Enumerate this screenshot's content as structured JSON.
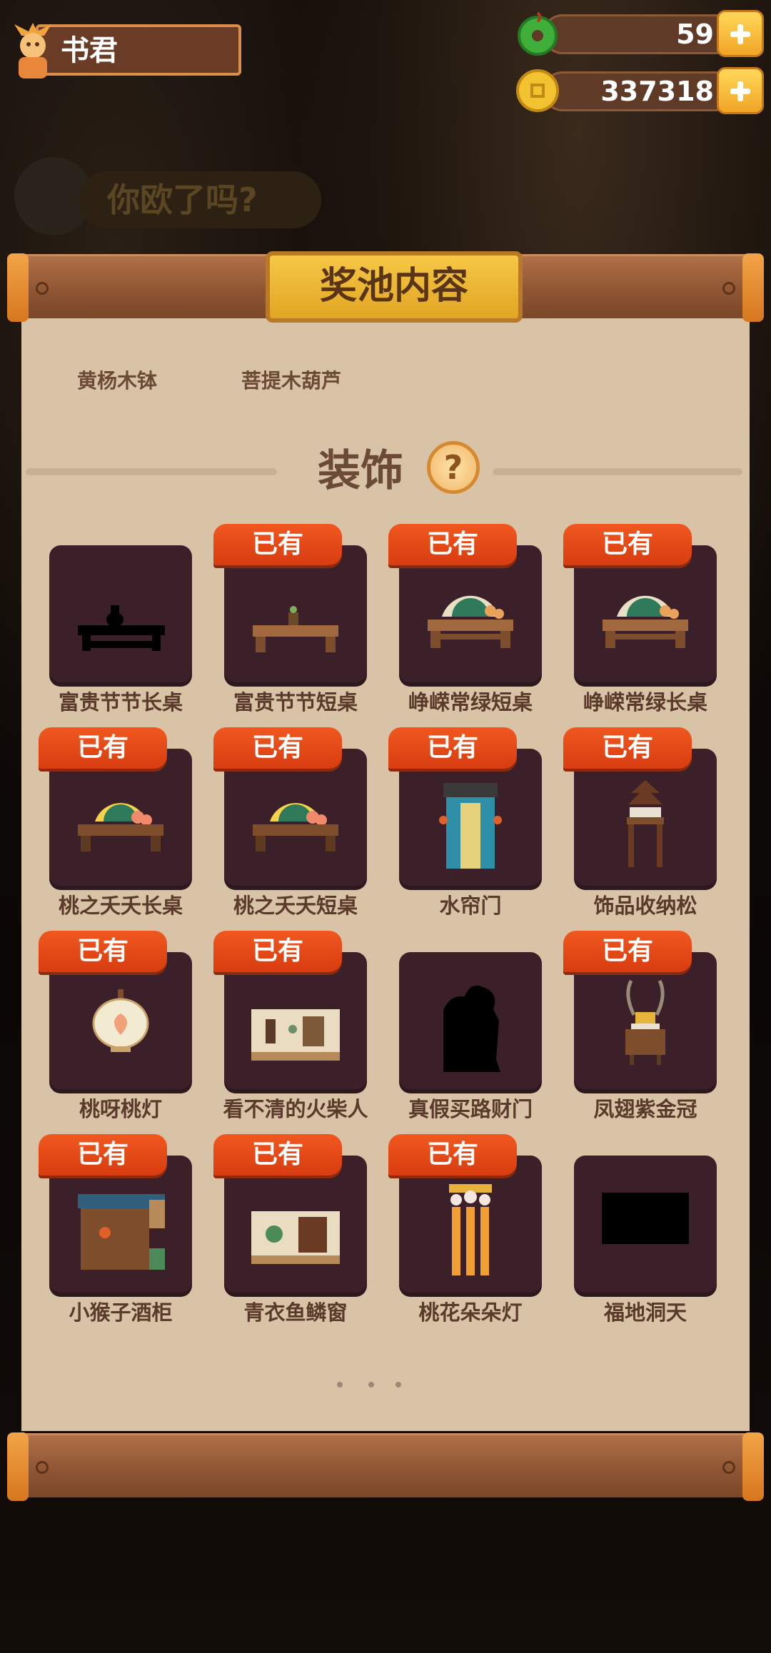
{
  "player": {
    "name": "书君"
  },
  "currencies": {
    "jade": {
      "value": "59",
      "icon": "jade-ring-icon"
    },
    "coin": {
      "value": "337318",
      "icon": "coin-icon"
    }
  },
  "background": {
    "banner_text": "你欧了吗?"
  },
  "modal": {
    "title": "奖池内容",
    "previous_items": [
      "黄杨木钵",
      "菩提木葫芦"
    ],
    "section_title": "装饰",
    "help_symbol": "?",
    "owned_label": "已有",
    "items": [
      {
        "name": "富贵节节长桌",
        "owned": false,
        "icon": "long-table-icon"
      },
      {
        "name": "富贵节节短桌",
        "owned": true,
        "icon": "short-table-icon"
      },
      {
        "name": "峥嵘常绿短桌",
        "owned": true,
        "icon": "fan-table-icon"
      },
      {
        "name": "峥嵘常绿长桌",
        "owned": true,
        "icon": "fan-table-icon"
      },
      {
        "name": "桃之夭夭长桌",
        "owned": true,
        "icon": "peach-fan-table-icon"
      },
      {
        "name": "桃之夭夭短桌",
        "owned": true,
        "icon": "peach-fan-table-icon"
      },
      {
        "name": "水帘门",
        "owned": true,
        "icon": "curtain-door-icon"
      },
      {
        "name": "饰品收纳松",
        "owned": true,
        "icon": "pine-stand-icon"
      },
      {
        "name": "桃呀桃灯",
        "owned": true,
        "icon": "peach-lantern-icon"
      },
      {
        "name": "看不清的火柴人",
        "owned": true,
        "icon": "room-scene-icon"
      },
      {
        "name": "真假买路财门",
        "owned": false,
        "icon": "silhouette-icon"
      },
      {
        "name": "凤翅紫金冠",
        "owned": true,
        "icon": "crown-cabinet-icon"
      },
      {
        "name": "小猴子酒柜",
        "owned": true,
        "icon": "wine-cabinet-icon"
      },
      {
        "name": "青衣鱼鳞窗",
        "owned": true,
        "icon": "window-scene-icon"
      },
      {
        "name": "桃花朵朵灯",
        "owned": true,
        "icon": "blossom-lamp-icon"
      },
      {
        "name": "福地洞天",
        "owned": false,
        "icon": "black-block-icon"
      }
    ]
  }
}
